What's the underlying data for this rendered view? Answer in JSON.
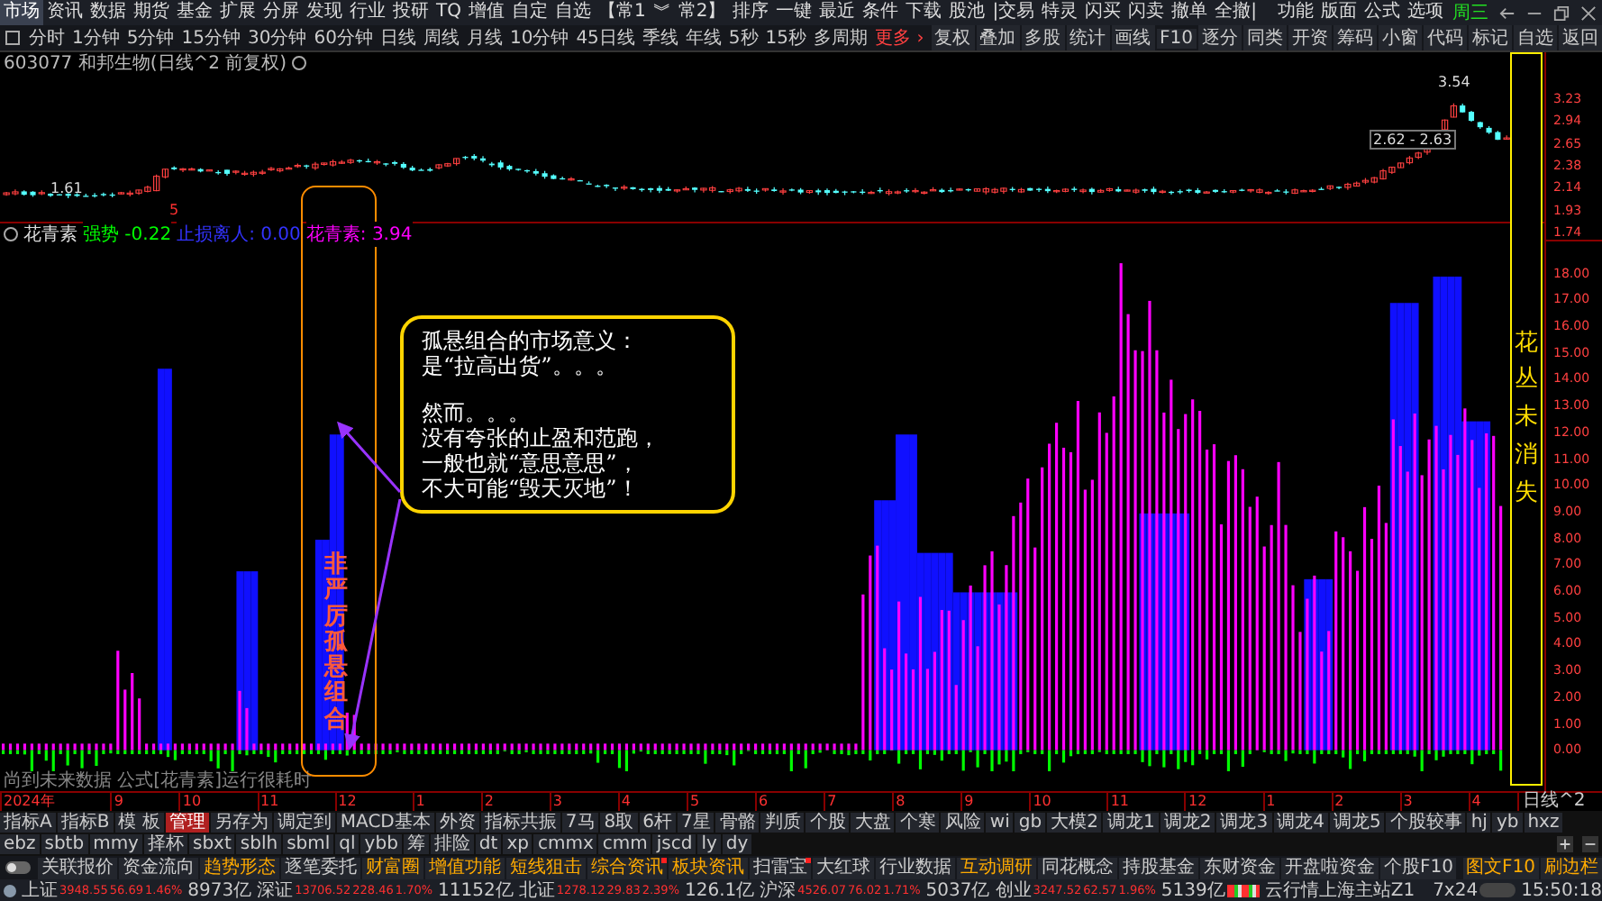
{
  "menu": {
    "items": [
      {
        "label": "市场",
        "selected": true
      },
      {
        "label": "资讯",
        "selected": false
      },
      {
        "label": "数据",
        "selected": false
      },
      {
        "label": "期货",
        "selected": false
      },
      {
        "label": "基金",
        "selected": false
      },
      {
        "label": "扩展",
        "selected": false
      },
      {
        "label": "分屏",
        "selected": false
      },
      {
        "label": "发现",
        "selected": false
      },
      {
        "label": "行业",
        "selected": false
      },
      {
        "label": "投研",
        "selected": false
      },
      {
        "label": "TQ",
        "selected": false
      },
      {
        "label": "增值",
        "selected": false
      },
      {
        "label": "自定",
        "selected": false
      },
      {
        "label": "自选",
        "selected": false
      },
      {
        "label": "【常1",
        "selected": false
      },
      {
        "label": "︾",
        "selected": false
      },
      {
        "label": "常2】",
        "selected": false
      },
      {
        "label": "排序",
        "selected": false
      },
      {
        "label": "一键",
        "selected": false
      },
      {
        "label": "最近",
        "selected": false
      },
      {
        "label": "条件",
        "selected": false
      },
      {
        "label": "下载",
        "selected": false
      },
      {
        "label": "股池",
        "selected": false
      },
      {
        "label": "|交易",
        "selected": false
      },
      {
        "label": "特灵",
        "selected": false
      },
      {
        "label": "闪买",
        "selected": false
      },
      {
        "label": "闪卖",
        "selected": false
      },
      {
        "label": "撤单",
        "selected": false
      },
      {
        "label": "全撤|",
        "selected": false
      }
    ],
    "right_items": [
      "功能",
      "版面",
      "公式",
      "选项"
    ],
    "weekday": "周三"
  },
  "period_bar": {
    "items": [
      "分时",
      "1分钟",
      "5分钟",
      "15分钟",
      "30分钟",
      "60分钟",
      "日线",
      "周线",
      "月线",
      "10分钟",
      "45日线",
      "季线",
      "年线",
      "5秒",
      "15秒",
      "多周期"
    ],
    "more": "更多 ›",
    "tools": [
      "复权",
      "叠加",
      "多股",
      "统计",
      "画线",
      "F10",
      "逐分",
      "同类",
      "开资",
      "筹码",
      "小窗",
      "代码",
      "标记",
      "自选",
      "返回"
    ]
  },
  "chart": {
    "title": "603077 和邦生物(日线^2 前复权)",
    "price_axis": [
      "3.23",
      "2.94",
      "2.65",
      "2.38",
      "2.14",
      "1.93",
      "1.74"
    ],
    "low_label": "1.61",
    "high_label": "3.54",
    "range_label": "2.62 - 2.63",
    "event_marker": "5"
  },
  "indicator": {
    "name": "花青素",
    "fields": [
      {
        "text": "强势 -0.22",
        "color": "#00ff00"
      },
      {
        "text": "止损离人: 0.00",
        "color": "#3333ff"
      },
      {
        "text": "花青素: 3.94",
        "color": "#ff00ff"
      }
    ],
    "axis": [
      "18.00",
      "17.00",
      "16.00",
      "15.00",
      "14.00",
      "13.00",
      "12.00",
      "11.00",
      "10.00",
      "9.00",
      "8.00",
      "7.00",
      "6.00",
      "5.00",
      "4.00",
      "3.00",
      "2.00",
      "1.00",
      "0.00"
    ],
    "note": "尚到未来数据 公式[花青素]运行很耗时"
  },
  "timeline": {
    "labels": [
      "2024年",
      "9",
      "10",
      "11",
      "12",
      "1",
      "2",
      "3",
      "4",
      "5",
      "6",
      "7",
      "8",
      "9",
      "10",
      "11",
      "12",
      "1",
      "2",
      "3",
      "4"
    ],
    "period": "日线^2"
  },
  "indicator_tabs": [
    {
      "label": "指标A",
      "selected": false
    },
    {
      "label": "指标B",
      "selected": false
    },
    {
      "label": "模 板",
      "selected": false
    },
    {
      "label": "管理",
      "selected": true
    },
    {
      "label": "另存为",
      "selected": false
    },
    {
      "label": "调定到",
      "selected": false
    },
    {
      "label": "MACD基本",
      "selected": false
    },
    {
      "label": "外资",
      "selected": false
    },
    {
      "label": "指标共振",
      "selected": false
    },
    {
      "label": "7马",
      "selected": false
    },
    {
      "label": "8取",
      "selected": false
    },
    {
      "label": "6杆",
      "selected": false
    },
    {
      "label": "7星",
      "selected": false
    },
    {
      "label": "骨骼",
      "selected": false
    },
    {
      "label": "判质",
      "selected": false
    },
    {
      "label": "个股",
      "selected": false
    },
    {
      "label": "大盘",
      "selected": false
    },
    {
      "label": "个寒",
      "selected": false
    },
    {
      "label": "风险",
      "selected": false
    },
    {
      "label": "wi",
      "selected": false
    },
    {
      "label": "gb",
      "selected": false
    },
    {
      "label": "大模2",
      "selected": false
    },
    {
      "label": "调龙1",
      "selected": false
    },
    {
      "label": "调龙2",
      "selected": false
    },
    {
      "label": "调龙3",
      "selected": false
    },
    {
      "label": "调龙4",
      "selected": false
    },
    {
      "label": "调龙5",
      "selected": false
    },
    {
      "label": "个股较事",
      "selected": false
    },
    {
      "label": "hj",
      "selected": false
    },
    {
      "label": "yb",
      "selected": false
    },
    {
      "label": "hxz",
      "selected": false
    },
    {
      "label": "ebz",
      "selected": false
    },
    {
      "label": "sbtb",
      "selected": false
    },
    {
      "label": "mmy",
      "selected": false
    },
    {
      "label": "择杯",
      "selected": false
    },
    {
      "label": "sbxt",
      "selected": false
    },
    {
      "label": "sblh",
      "selected": false
    },
    {
      "label": "sbml",
      "selected": false
    },
    {
      "label": "ql",
      "selected": false
    },
    {
      "label": "ybb",
      "selected": false
    },
    {
      "label": "筹",
      "selected": false
    },
    {
      "label": "排险",
      "selected": false
    },
    {
      "label": "dt",
      "selected": false
    },
    {
      "label": "xp",
      "selected": false
    },
    {
      "label": "cmmx",
      "selected": false
    },
    {
      "label": "cmm",
      "selected": false
    },
    {
      "label": "jscd",
      "selected": false
    },
    {
      "label": "ly",
      "selected": false
    },
    {
      "label": "dy",
      "selected": false
    }
  ],
  "tool_row": {
    "toggle": {
      "on": false
    },
    "items": [
      {
        "label": "关联报价",
        "highlight": false,
        "badge": false
      },
      {
        "label": "资金流向",
        "highlight": false,
        "badge": false
      },
      {
        "label": "趋势形态",
        "highlight": true,
        "badge": false
      },
      {
        "label": "逐笔委托",
        "highlight": false,
        "badge": false
      },
      {
        "label": "财富圈",
        "highlight": true,
        "badge": false
      },
      {
        "label": "增值功能",
        "highlight": true,
        "badge": false
      },
      {
        "label": "短线狙击",
        "highlight": true,
        "badge": false
      },
      {
        "label": "综合资讯",
        "highlight": true,
        "badge": true
      },
      {
        "label": "板块资讯",
        "highlight": true,
        "badge": false
      },
      {
        "label": "扫雷宝",
        "highlight": false,
        "badge": true
      },
      {
        "label": "大红球",
        "highlight": false,
        "badge": false
      },
      {
        "label": "行业数据",
        "highlight": false,
        "badge": false
      },
      {
        "label": "互动调研",
        "highlight": true,
        "badge": false
      },
      {
        "label": "同花概念",
        "highlight": false,
        "badge": false
      },
      {
        "label": "持股基金",
        "highlight": false,
        "badge": false
      },
      {
        "label": "东财资金",
        "highlight": false,
        "badge": false
      },
      {
        "label": "开盘啦资金",
        "highlight": false,
        "badge": false
      },
      {
        "label": "个股F10",
        "highlight": false,
        "badge": false
      }
    ],
    "right": [
      "图文F10",
      "刷边栏"
    ]
  },
  "status": {
    "indices": [
      {
        "name": "上证",
        "value": "3948.55",
        "change": "56.69",
        "pct": "1.46%",
        "volume": "8973亿"
      },
      {
        "name": "深证",
        "value": "13706.52",
        "change": "228.46",
        "pct": "1.70%",
        "volume": "11152亿"
      },
      {
        "name": "北证",
        "value": "1278.12",
        "change": "29.83",
        "pct": "2.39%",
        "volume": "126.1亿"
      },
      {
        "name": "沪深",
        "value": "4526.07",
        "change": "76.02",
        "pct": "1.71%",
        "volume": "5037亿"
      },
      {
        "name": "创业",
        "value": "3247.52",
        "change": "62.57",
        "pct": "1.96%",
        "volume": "5139亿"
      }
    ],
    "server": "云行情上海主站Z1",
    "news": "7x24",
    "time": "15:50:18"
  },
  "annotations": {
    "vertical_label": "非严厉孤悬组合",
    "callout": [
      [
        "孤悬组合的市场意义：",
        "是“拉高出货”。。。"
      ],
      [
        "然而。。。",
        "没有夸张的止盈和范跑，",
        "一般也就“意思意思”，",
        "不大可能“毁天灭地”！"
      ]
    ],
    "side_label": "花丛未消失"
  }
}
